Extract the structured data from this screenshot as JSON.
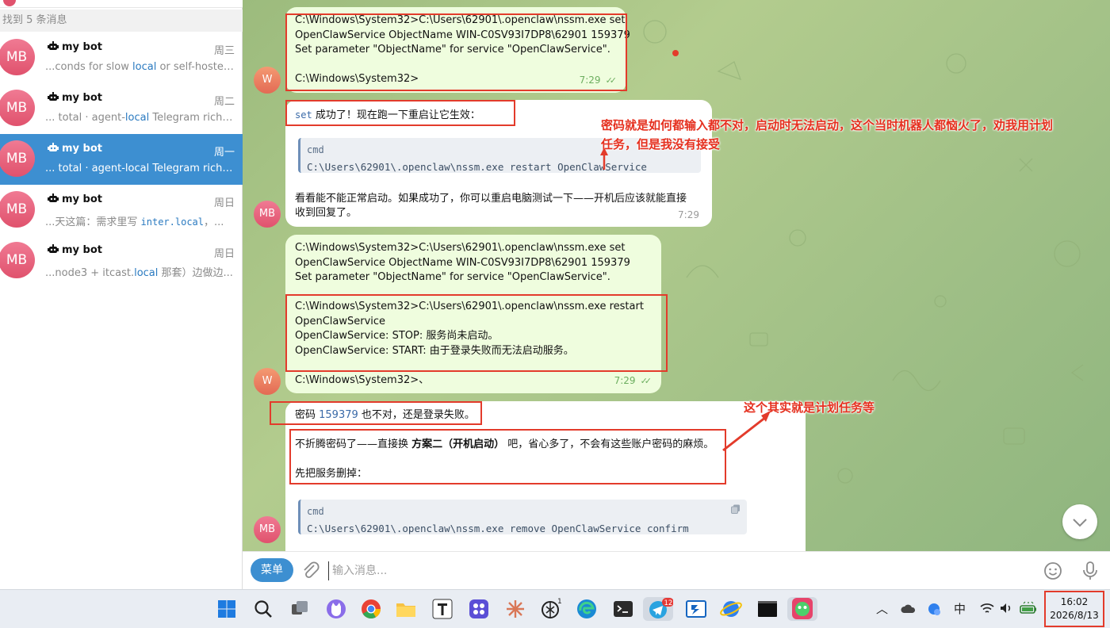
{
  "sidebar": {
    "found_label": "找到 5 条消息",
    "chats": [
      {
        "avatar": "MB",
        "name": "my bot",
        "day": "周三",
        "snippet_pre": "...conds for slow ",
        "snippet_hl": "local",
        "snippet_post": " or self-hosted..."
      },
      {
        "avatar": "MB",
        "name": "my bot",
        "day": "周二",
        "snippet_pre": "... total · agent-",
        "snippet_hl": "local",
        "snippet_post": " Telegram rich m..."
      },
      {
        "avatar": "MB",
        "name": "my bot",
        "day": "周一",
        "snippet_pre": "... total · agent-local Telegram rich m...",
        "snippet_hl": "",
        "snippet_post": ""
      },
      {
        "avatar": "MB",
        "name": "my bot",
        "day": "周日",
        "snippet_pre": "...天这篇：需求里写 ",
        "snippet_hl": "inter.local",
        "snippet_post": "，..."
      },
      {
        "avatar": "MB",
        "name": "my bot",
        "day": "周日",
        "snippet_pre": "...node3 + itcast.",
        "snippet_hl": "local",
        "snippet_post": " 那套）边做边..."
      }
    ]
  },
  "messages": {
    "m1": {
      "lines": [
        "C:\\Windows\\System32>C:\\Users\\62901\\.openclaw\\nssm.exe set",
        "OpenClawService ObjectName WIN-C0SV93I7DP8\\62901 159379",
        "Set parameter \"ObjectName\" for service \"OpenClawService\".",
        "",
        "C:\\Windows\\System32>"
      ],
      "time": "7:29",
      "avatar": "W"
    },
    "m2": {
      "code_word": "set",
      "text_after": " 成功了！现在跑一下重启让它生效：",
      "code_lang": "cmd",
      "code": "C:\\Users\\62901\\.openclaw\\nssm.exe restart OpenClawService",
      "para_1": "看看能不能正常启动。如果成功了，你可以重启电脑测试一下——开机后应该就能直接",
      "para_2": "收到回复了。",
      "time": "7:29",
      "avatar": "MB"
    },
    "m3": {
      "lines": [
        "C:\\Windows\\System32>C:\\Users\\62901\\.openclaw\\nssm.exe set",
        "OpenClawService ObjectName WIN-C0SV93I7DP8\\62901 159379",
        "Set parameter \"ObjectName\" for service \"OpenClawService\".",
        "",
        "C:\\Windows\\System32>C:\\Users\\62901\\.openclaw\\nssm.exe restart",
        "OpenClawService",
        "OpenClawService: STOP: 服务尚未启动。",
        "OpenClawService: START: 由于登录失败而无法启动服务。",
        "",
        "C:\\Windows\\System32>、"
      ],
      "time": "7:29",
      "avatar": "W"
    },
    "m4": {
      "line1_pre": "密码 ",
      "line1_num": "159379",
      "line1_post": " 也不对，还是登录失败。",
      "line2_pre": "不折腾密码了——直接换 ",
      "line2_bold": "方案二（开机启动）",
      "line2_post": " 吧，省心多了，不会有这些账户密码的麻烦。",
      "line3": "先把服务删掉：",
      "code_lang": "cmd",
      "code": "C:\\Users\\62901\\.openclaw\\nssm.exe remove OpenClawService confirm",
      "avatar": "MB"
    }
  },
  "annotations": {
    "a1_line1": "密码就是如何都输入都不对，启动时无法启动，这个当时机器人都恼火了，劝我用计划",
    "a1_line2": "任务，但是我没有接受",
    "a2": "这个其实就是计划任务等"
  },
  "composer": {
    "menu_label": "菜单",
    "placeholder": "输入消息..."
  },
  "taskbar": {
    "telegram_badge": "12",
    "chatgpt_badge": "1",
    "ime": "中",
    "time": "16:02",
    "date": "2026/8/13"
  },
  "colors": {
    "accent": "#3d8fd1",
    "annotation_red": "#e33b2b",
    "outgoing_bubble": "#effdde",
    "avatar_pink": "#e0526d"
  }
}
